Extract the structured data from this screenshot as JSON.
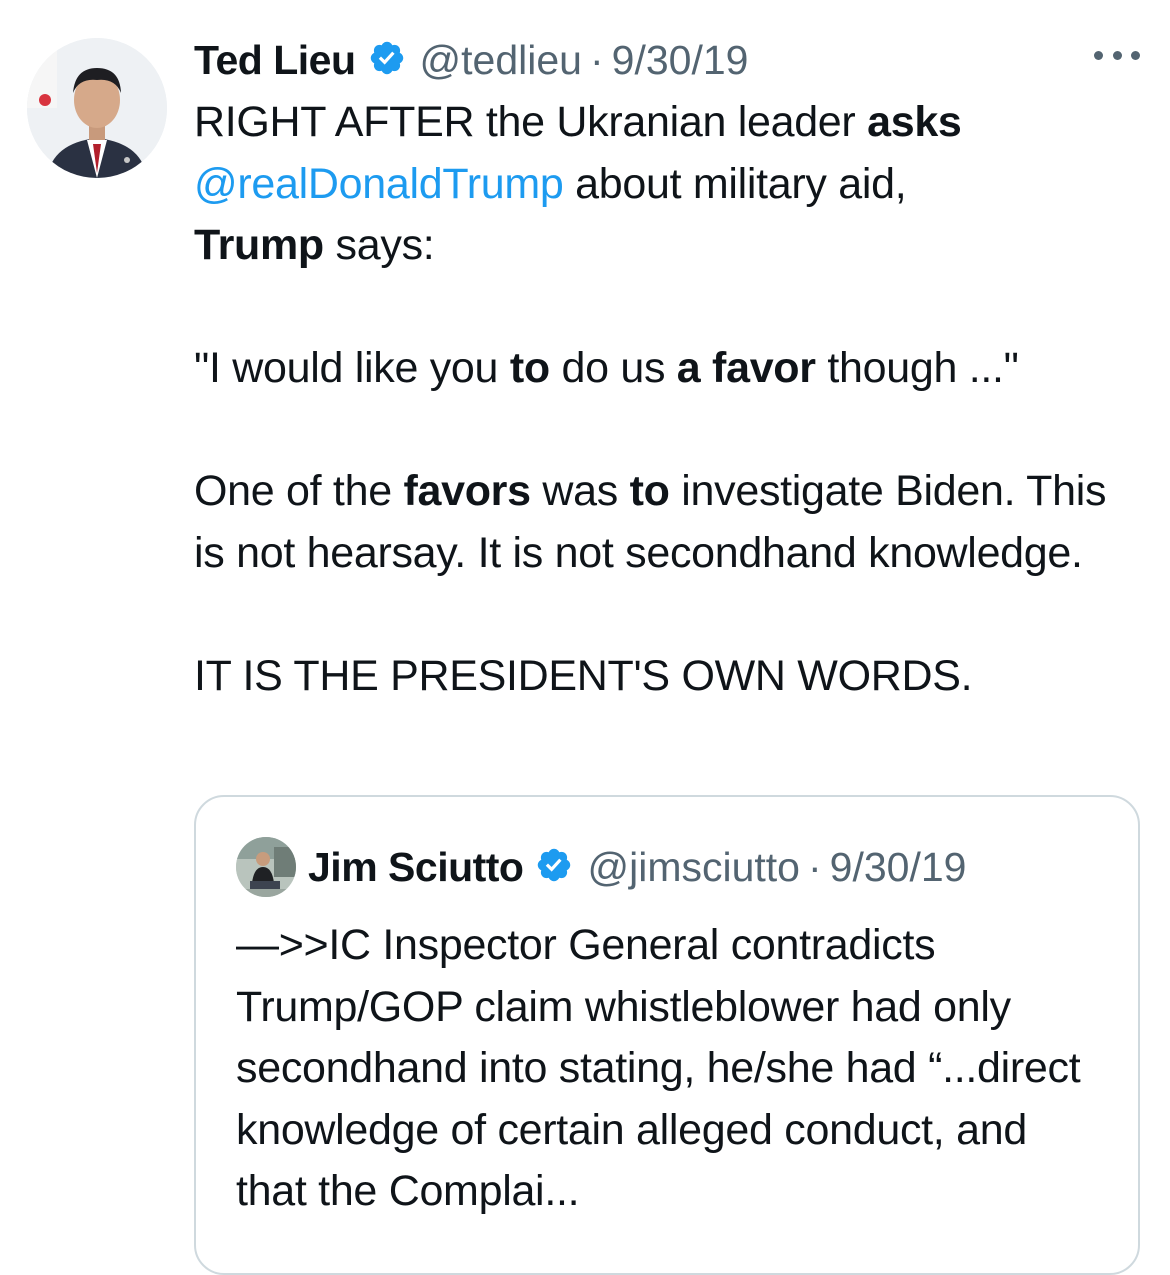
{
  "tweet": {
    "author_name": "Ted Lieu",
    "handle": "@tedlieu",
    "separator": "·",
    "date": "9/30/19",
    "body": {
      "line1_a": "RIGHT AFTER the Ukranian leader ",
      "line1_b": "asks",
      "mention": "@realDonaldTrump",
      "line2_a": " about military aid,",
      "line3_b": "Trump",
      "line3_a": " says:",
      "quote_a": "\"I would like you ",
      "quote_b": "to",
      "quote_c": " do us ",
      "quote_d": "a favor",
      "quote_e": " though ...\"",
      "p3_a": "One of the ",
      "p3_b": "favors",
      "p3_c": " was ",
      "p3_d": "to",
      "p3_e": " investigate Biden. This is not hearsay. It is not secondhand knowledge.",
      "p4": "IT IS THE PRESIDENT'S OWN WORDS."
    }
  },
  "quoted_tweet": {
    "author_name": "Jim Sciutto",
    "handle": "@jimsciutto",
    "separator": "·",
    "date": "9/30/19",
    "body": "—>>IC Inspector General contradicts Trump/GOP claim whistleblower had only secondhand into stating, he/she had “...direct knowledge of certain alleged conduct, and that the Complai..."
  },
  "colors": {
    "link": "#1d9bf0",
    "secondary_text": "#536471",
    "border": "#cfd9de",
    "verified": "#1d9bf0"
  },
  "icons": [
    "verified-badge-icon",
    "more-options-icon",
    "avatar"
  ]
}
